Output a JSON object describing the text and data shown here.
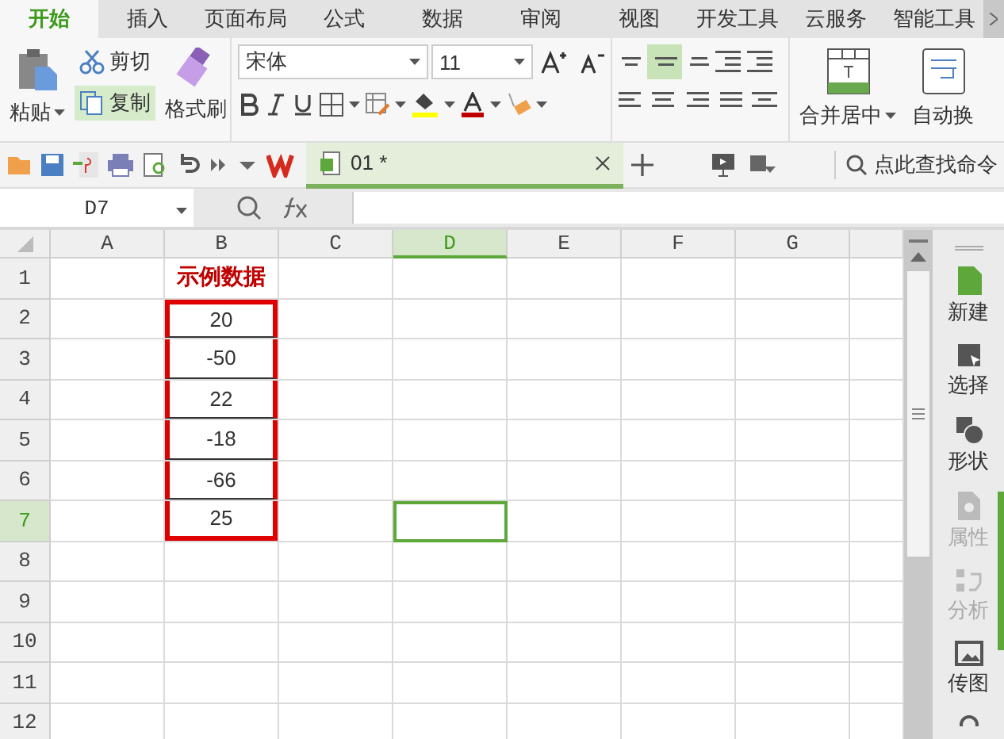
{
  "menu_tabs": [
    {
      "label": "开始",
      "selected": true
    },
    {
      "label": "插入",
      "selected": false
    },
    {
      "label": "页面布局",
      "selected": false
    },
    {
      "label": "公式",
      "selected": false
    },
    {
      "label": "数据",
      "selected": false
    },
    {
      "label": "审阅",
      "selected": false
    },
    {
      "label": "视图",
      "selected": false
    },
    {
      "label": "开发工具",
      "selected": false
    },
    {
      "label": "云服务",
      "selected": false
    },
    {
      "label": "智能工具",
      "selected": false
    }
  ],
  "ribbon": {
    "paste": "粘贴",
    "cut": "剪切",
    "copy": {
      "label": "复制",
      "selected": true
    },
    "format_painter": "格式刷",
    "font_name": "宋体",
    "font_size": "11",
    "align_selected": {
      "top_center": true
    },
    "merge": "合并居中",
    "wrap": "自动换"
  },
  "quick_bar": {
    "document_tab": {
      "label": "01 *",
      "selected": true
    },
    "search": "点此查找命令"
  },
  "formula_bar": {
    "name_box": "D7"
  },
  "sheet": {
    "columns": [
      {
        "label": "A",
        "selected": false
      },
      {
        "label": "B",
        "selected": false
      },
      {
        "label": "C",
        "selected": false
      },
      {
        "label": "D",
        "selected": true
      },
      {
        "label": "E",
        "selected": false
      },
      {
        "label": "F",
        "selected": false
      },
      {
        "label": "G",
        "selected": false
      }
    ],
    "rows": [
      {
        "label": "1",
        "selected": false,
        "column_b": {
          "kind": "title",
          "text": "示例数据"
        }
      },
      {
        "label": "2",
        "selected": false,
        "column_b": {
          "kind": "value",
          "text": "20"
        }
      },
      {
        "label": "3",
        "selected": false,
        "column_b": {
          "kind": "value",
          "text": "-50"
        }
      },
      {
        "label": "4",
        "selected": false,
        "column_b": {
          "kind": "value",
          "text": "22"
        }
      },
      {
        "label": "5",
        "selected": false,
        "column_b": {
          "kind": "value",
          "text": "-18"
        }
      },
      {
        "label": "6",
        "selected": false,
        "column_b": {
          "kind": "value",
          "text": "-66"
        }
      },
      {
        "label": "7",
        "selected": true,
        "column_b": {
          "kind": "value",
          "text": "25"
        }
      },
      {
        "label": "8",
        "selected": false
      },
      {
        "label": "9",
        "selected": false
      },
      {
        "label": "10",
        "selected": false
      },
      {
        "label": "11",
        "selected": false
      },
      {
        "label": "12",
        "selected": false
      }
    ]
  },
  "side_panel": [
    {
      "label": "新建",
      "kind": "new",
      "disabled": false
    },
    {
      "label": "选择",
      "kind": "select",
      "disabled": false
    },
    {
      "label": "形状",
      "kind": "shape",
      "disabled": false
    },
    {
      "label": "属性",
      "kind": "property",
      "disabled": true
    },
    {
      "label": "分析",
      "kind": "analyze",
      "disabled": true
    },
    {
      "label": "传图",
      "kind": "image",
      "disabled": false
    }
  ]
}
